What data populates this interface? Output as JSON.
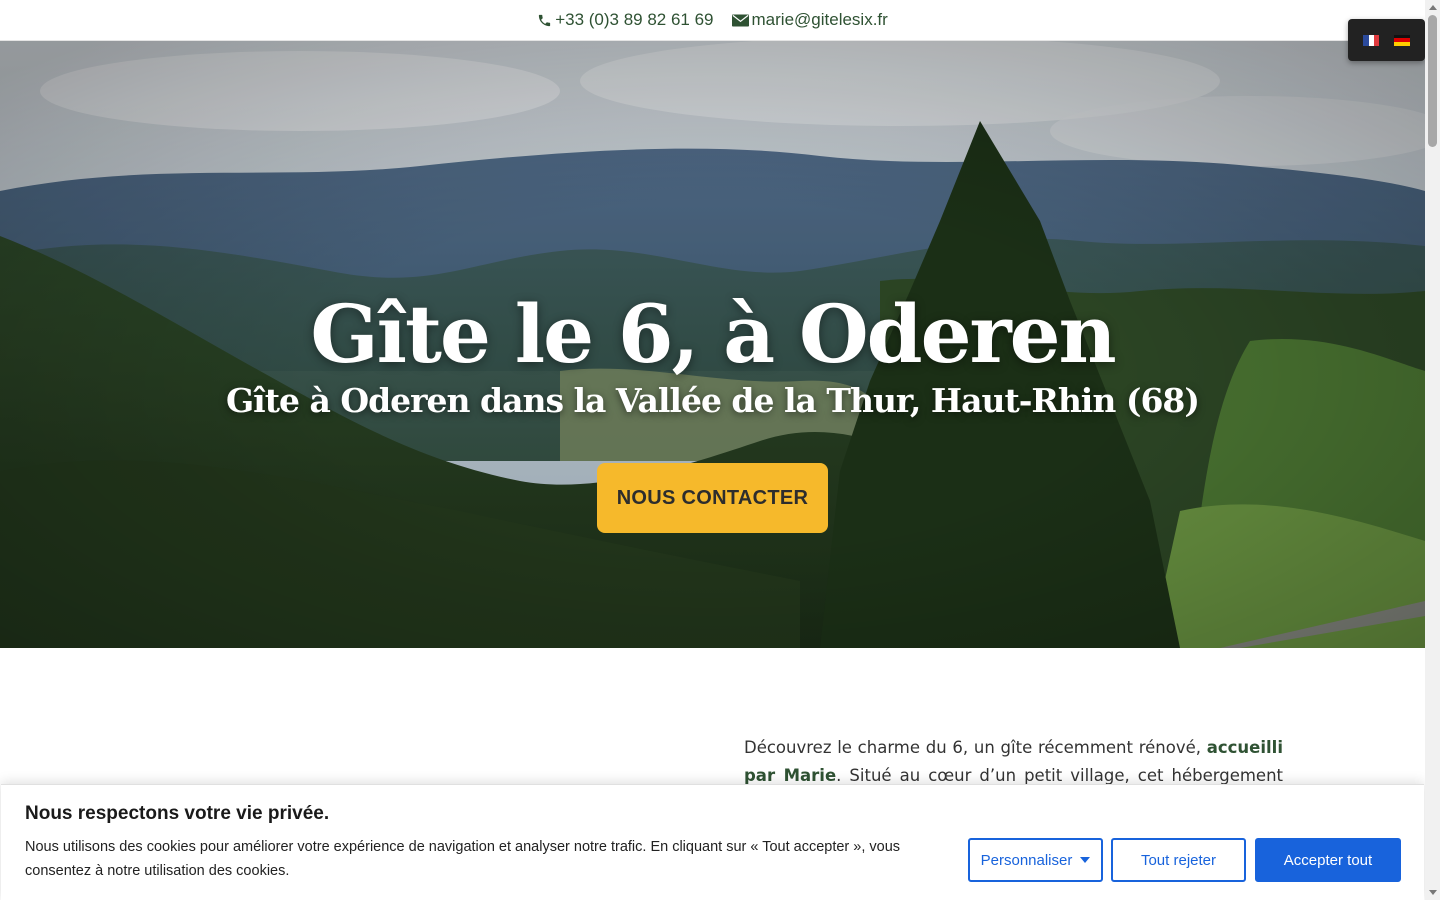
{
  "topbar": {
    "phone": "+33 (0)3 89 82 61 69",
    "email": "marie@gitelesix.fr",
    "phone_icon": "phone-icon",
    "email_icon": "envelope-icon",
    "color": "#2f5233"
  },
  "language_switcher": {
    "languages": [
      "fr",
      "de"
    ]
  },
  "hero": {
    "title": "Gîte le 6, à Oderen",
    "subtitle": "Gîte à Oderen dans la Vallée de la Thur, Haut-Rhin (68)",
    "cta_label": "NOUS CONTACTER",
    "cta_color": "#f6b92b"
  },
  "intro": {
    "part1": "Découvrez le charme du 6, un gîte récemment rénové, ",
    "highlight": "accueilli par Marie",
    "part2": ". Situé au cœur d’un petit village, cet hébergement est parfait pour"
  },
  "cookie_banner": {
    "title": "Nous respectons votre vie privée.",
    "description": "Nous utilisons des cookies pour améliorer votre expérience de navigation et analyser notre trafic. En cliquant sur « Tout accepter », vous consentez à notre utilisation des cookies.",
    "customize_label": "Personnaliser",
    "reject_label": "Tout rejeter",
    "accept_label": "Accepter tout",
    "accent_color": "#1863dc"
  }
}
